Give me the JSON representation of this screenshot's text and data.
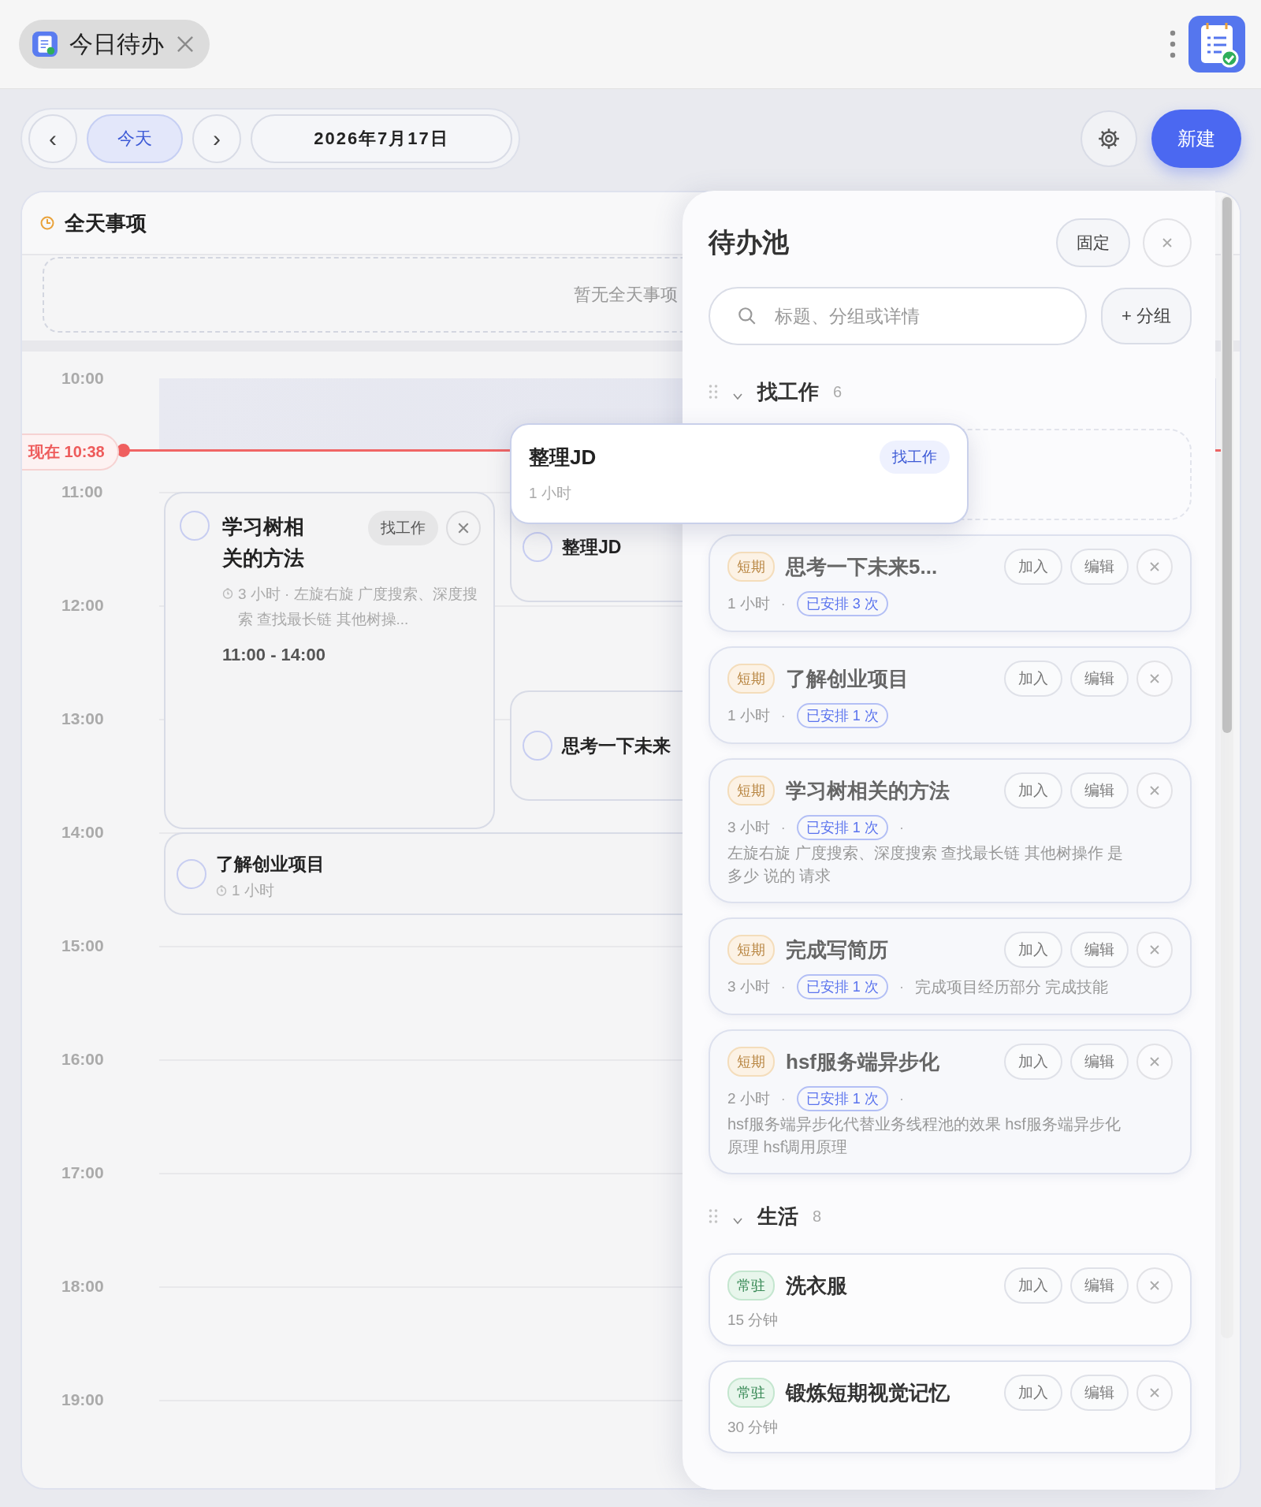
{
  "tab": {
    "title": "今日待办"
  },
  "toolbar": {
    "prev": "‹",
    "today": {
      "label": "今天",
      "selected": true
    },
    "next": "›",
    "date": "2026年7月17日",
    "new_button": "新建"
  },
  "all_day": {
    "title": "全天事项",
    "empty": "暂无全天事项"
  },
  "timeline": {
    "hours": [
      "10:00",
      "11:00",
      "12:00",
      "13:00",
      "14:00",
      "15:00",
      "16:00",
      "17:00",
      "18:00",
      "19:00"
    ],
    "now_label": "现在 10:38",
    "events": [
      {
        "title": "学习树相关的方法",
        "done": false,
        "tag": "找工作",
        "meta": "3 小时 · 左旋右旋 广度搜索、深度搜索 查找最长链 其他树操...",
        "time": "11:00 - 14:00"
      },
      {
        "title": "整理JD",
        "done": false
      },
      {
        "title": "思考一下未来",
        "done": false
      },
      {
        "title": "了解创业项目",
        "done": false,
        "meta": "1 小时"
      }
    ]
  },
  "drag_preview": {
    "title": "整理JD",
    "tag": "找工作",
    "duration": "1 小时"
  },
  "pool": {
    "title": "待办池",
    "pin_button": "固定",
    "search_placeholder": "标题、分组或详情",
    "add_group_button": "+ 分组",
    "groups": [
      {
        "name": "找工作",
        "count": "6",
        "expanded": true,
        "items": [
          {
            "kind": "short",
            "badge": "短期",
            "title": "思考一下未来5...",
            "actions": [
              "加入",
              "编辑"
            ],
            "meta": [
              {
                "kind": "text",
                "text": "1 小时"
              },
              {
                "kind": "sep",
                "text": "·"
              },
              {
                "kind": "scheduled",
                "text": "已安排 3 次"
              }
            ]
          },
          {
            "kind": "short",
            "badge": "短期",
            "title": "了解创业项目",
            "actions": [
              "加入",
              "编辑"
            ],
            "meta": [
              {
                "kind": "text",
                "text": "1 小时"
              },
              {
                "kind": "sep",
                "text": "·"
              },
              {
                "kind": "scheduled",
                "text": "已安排 1 次"
              }
            ]
          },
          {
            "kind": "short",
            "badge": "短期",
            "title": "学习树相关的方法",
            "actions": [
              "加入",
              "编辑"
            ],
            "meta": [
              {
                "kind": "text",
                "text": "3 小时"
              },
              {
                "kind": "sep",
                "text": "·"
              },
              {
                "kind": "scheduled",
                "text": "已安排 1 次"
              },
              {
                "kind": "sep",
                "text": "·"
              },
              {
                "kind": "detail",
                "text": "左旋右旋 广度搜索、深度搜索 查找最长链 其他树操作 是多少 说的 请求"
              }
            ]
          },
          {
            "kind": "short",
            "badge": "短期",
            "title": "完成写简历",
            "actions": [
              "加入",
              "编辑"
            ],
            "meta": [
              {
                "kind": "text",
                "text": "3 小时"
              },
              {
                "kind": "sep",
                "text": "·"
              },
              {
                "kind": "scheduled",
                "text": "已安排 1 次"
              },
              {
                "kind": "sep",
                "text": "·"
              },
              {
                "kind": "detail",
                "text": "完成项目经历部分 完成技能"
              }
            ]
          },
          {
            "kind": "short",
            "badge": "短期",
            "title": "hsf服务端异步化",
            "actions": [
              "加入",
              "编辑"
            ],
            "meta": [
              {
                "kind": "text",
                "text": "2 小时"
              },
              {
                "kind": "sep",
                "text": "·"
              },
              {
                "kind": "scheduled",
                "text": "已安排 1 次"
              },
              {
                "kind": "sep",
                "text": "·"
              },
              {
                "kind": "detail",
                "text": "hsf服务端异步化代替业务线程池的效果 hsf服务端异步化原理 hsf调用原理"
              }
            ]
          }
        ]
      },
      {
        "name": "生活",
        "count": "8",
        "expanded": true,
        "items": [
          {
            "kind": "routine",
            "badge": "常驻",
            "title": "洗衣服",
            "actions": [
              "加入",
              "编辑"
            ],
            "meta": [
              {
                "kind": "text",
                "text": "15 分钟"
              }
            ]
          },
          {
            "kind": "routine",
            "badge": "常驻",
            "title": "锻炼短期视觉记忆",
            "actions": [
              "加入",
              "编辑"
            ],
            "meta": [
              {
                "kind": "text",
                "text": "30 分钟"
              }
            ]
          }
        ]
      }
    ]
  }
}
